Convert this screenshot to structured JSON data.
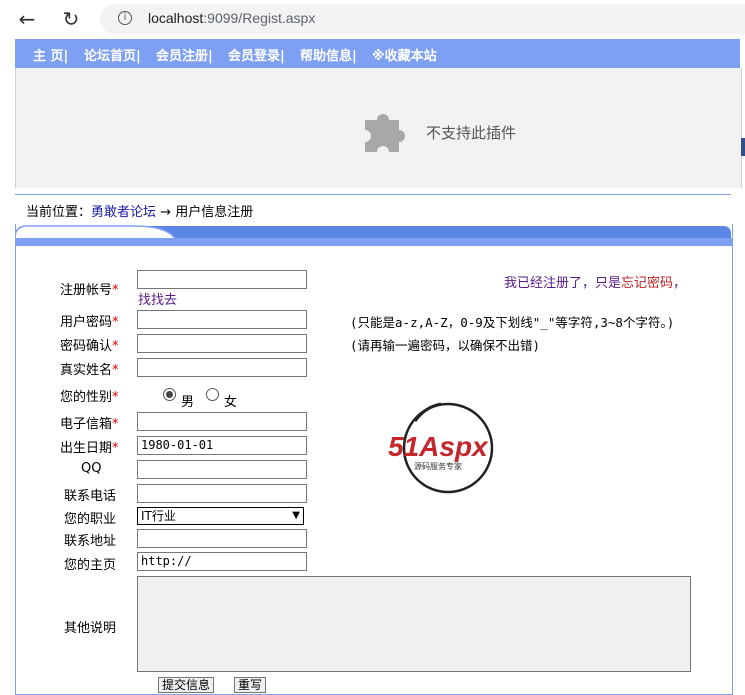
{
  "browser": {
    "url_host": "localhost",
    "url_rest": ":9099/Regist.aspx"
  },
  "menu": [
    "主 页|",
    "论坛首页|",
    "会员注册|",
    "会员登录|",
    "帮助信息|",
    "※收藏本站"
  ],
  "plugin": {
    "message": "不支持此插件"
  },
  "breadcrumb": {
    "prefix": "当前位置：",
    "forum": "勇敢者论坛",
    "arrow": "→",
    "page": "用户信息注册"
  },
  "form": {
    "account_label": "注册帐号",
    "password_label": "用户密码",
    "confirm_label": "密码确认",
    "realname_label": "真实姓名",
    "gender_label": "您的性别",
    "email_label": "电子信箱",
    "birthday_label": "出生日期",
    "qq_label": "QQ",
    "phone_label": "联系电话",
    "job_label": "您的职业",
    "address_label": "联系地址",
    "homepage_label": "您的主页",
    "other_label": "其他说明",
    "required_mark": "*",
    "gender_male": "男",
    "gender_female": "女",
    "birthday_value": "1980-01-01",
    "job_value": "IT行业",
    "homepage_value": "http://",
    "find_link": "找找去",
    "registered_prefix": "我已经注册了，只是",
    "forgot_link": "忘记密码",
    "registered_suffix": "，",
    "password_hint": "(只能是a-z,A-Z，0-9及下划线\"_\"等字符,3~8个字符。)",
    "confirm_hint": "(请再输一遍密码，以确保不出错)",
    "submit_button": "提交信息",
    "reset_button": "重写"
  },
  "logo": {
    "text": "51Aspx",
    "subtext": "源码服务专家"
  }
}
